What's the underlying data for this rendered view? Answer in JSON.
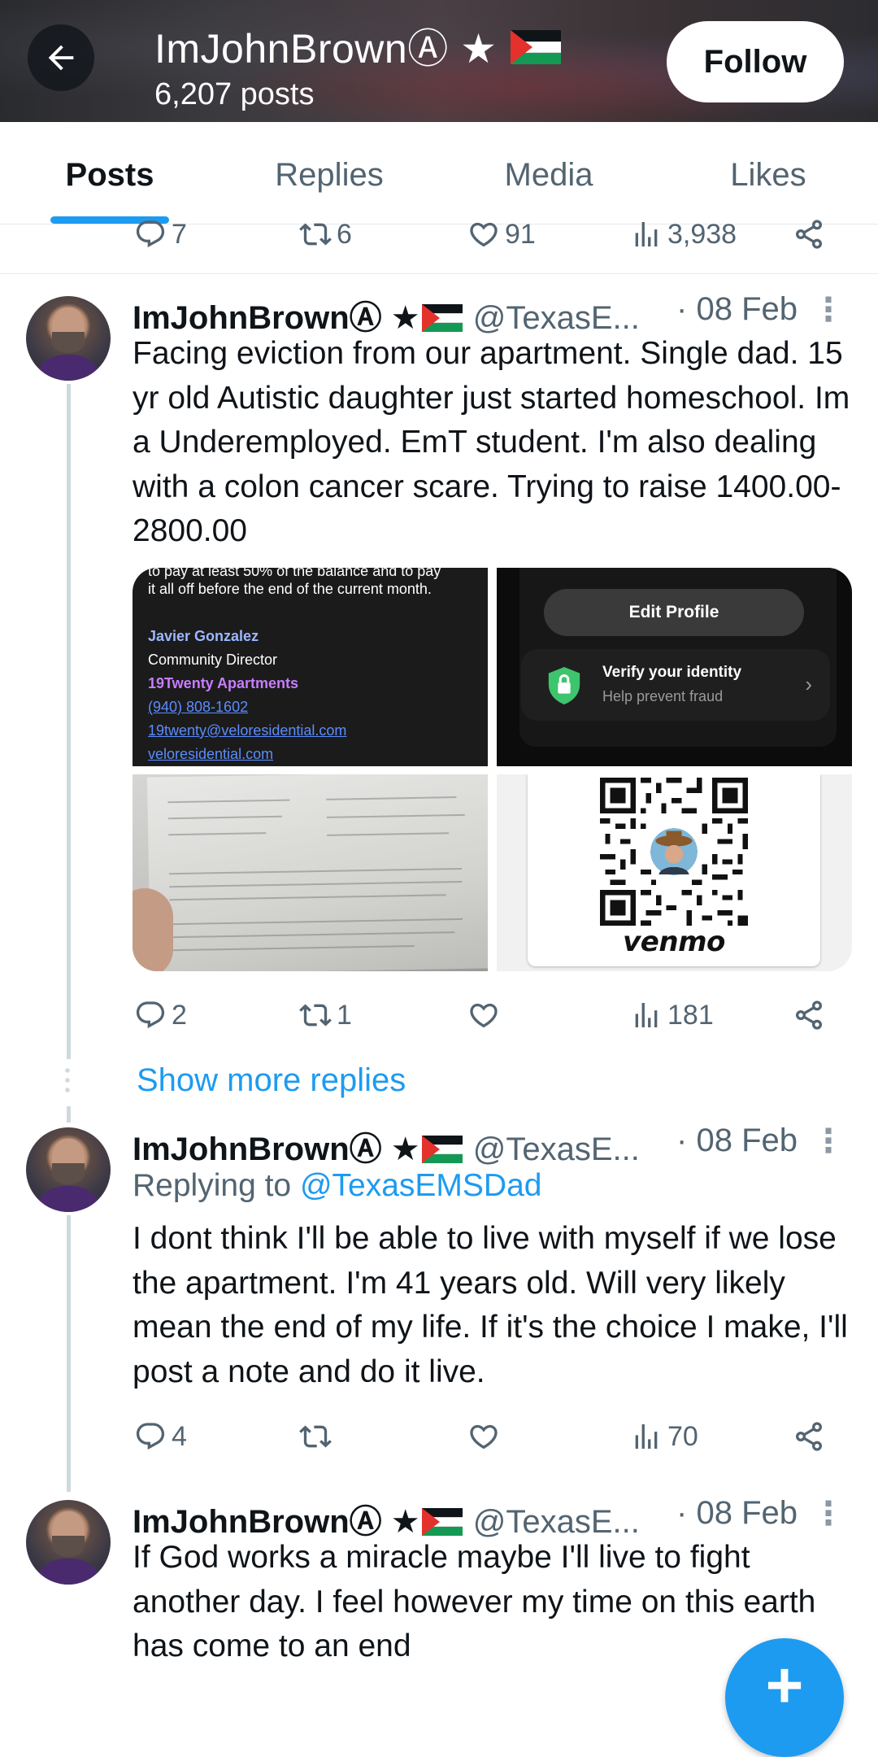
{
  "header": {
    "name": "ImJohnBrownⒶ ★",
    "posts_count": "6,207 posts",
    "follow_label": "Follow"
  },
  "tabs": [
    {
      "label": "Posts",
      "active": true
    },
    {
      "label": "Replies",
      "active": false
    },
    {
      "label": "Media",
      "active": false
    },
    {
      "label": "Likes",
      "active": false
    }
  ],
  "previous_tweet_stats": {
    "replies": "7",
    "reposts": "6",
    "likes": "91",
    "views": "3,938"
  },
  "tweets": [
    {
      "name": "ImJohnBrownⒶ ★",
      "handle": "@TexasE...",
      "date": "· 08 Feb",
      "text": "Facing eviction from our apartment. Single dad. 15 yr old Autistic daughter just started homeschool. Im a Underemployed. EmT student. I'm also dealing with a colon cancer scare. Trying to raise 1400.00-2800.00",
      "stats": {
        "replies": "2",
        "reposts": "1",
        "likes": "",
        "views": "181"
      }
    },
    {
      "name": "ImJohnBrownⒶ ★",
      "handle": "@TexasE...",
      "date": "· 08 Feb",
      "replying_prefix": "Replying to ",
      "replying_to": "@TexasEMSDad",
      "text": "I dont think I'll be able to live with myself if we lose the apartment. I'm 41 years old. Will very likely mean the end of my life. If it's the choice I make, I'll post a note and do it live.",
      "stats": {
        "replies": "4",
        "reposts": "",
        "likes": "",
        "views": "70"
      }
    },
    {
      "name": "ImJohnBrownⒶ ★",
      "handle": "@TexasE...",
      "date": "· 08 Feb",
      "text": "If God works a miracle maybe I'll live to fight another day. I feel however my time on this earth has come to an end"
    }
  ],
  "media": {
    "letter": {
      "line0": "to pay at least 50% of the balance and to pay",
      "line1": "it all off before the end of the current month.",
      "name": "Javier Gonzalez",
      "role": "Community Director",
      "company": "19Twenty Apartments",
      "phone": "(940) 808-1602",
      "email": "19twenty@veloresidential.com",
      "site": "veloresidential.com"
    },
    "profile": {
      "edit_label": "Edit Profile",
      "verify_title": "Verify your identity",
      "verify_sub": "Help prevent fraud"
    },
    "venmo_label": "venmo"
  },
  "show_more": "Show more replies",
  "colors": {
    "accent": "#1d9bf0",
    "muted": "#536471",
    "text": "#0f1419"
  },
  "icons": [
    "arrow-left-icon",
    "reply-icon",
    "repost-icon",
    "like-icon",
    "views-icon",
    "share-icon",
    "more-icon",
    "plus-icon",
    "shield-icon",
    "chevron-right-icon",
    "palestine-flag-icon"
  ]
}
